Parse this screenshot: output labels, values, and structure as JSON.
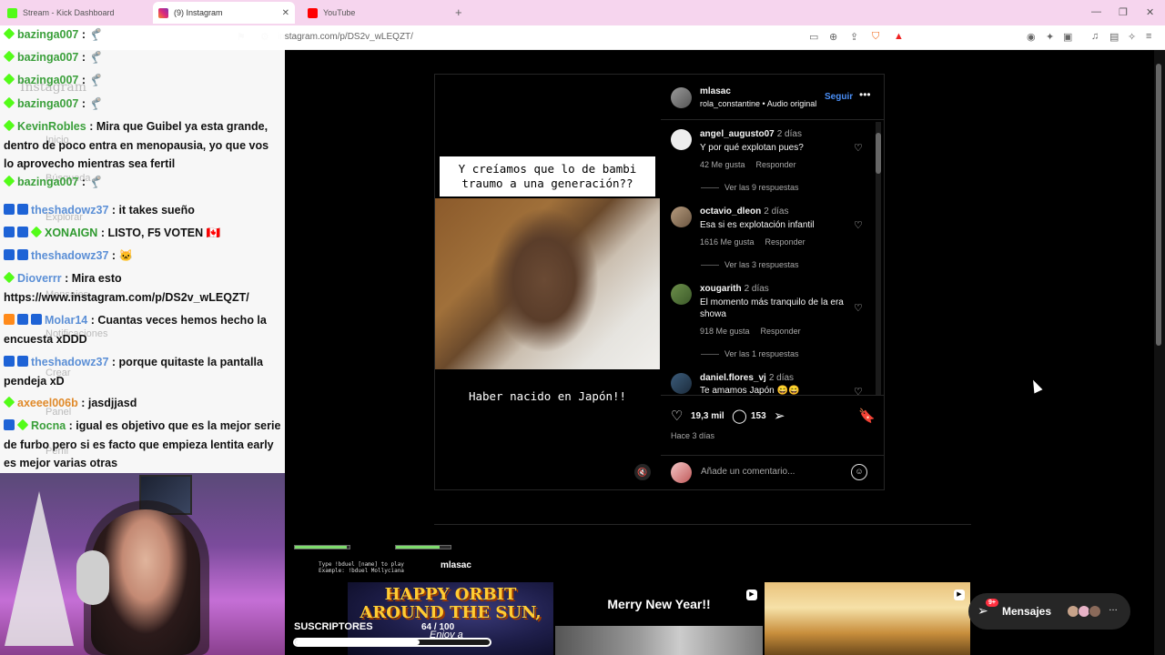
{
  "browser": {
    "tabs": [
      {
        "title": "Stream - Kick Dashboard",
        "active": false
      },
      {
        "title": "(9) Instagram",
        "active": true
      },
      {
        "title": "YouTube",
        "active": false
      }
    ],
    "url": "instagram.com/p/DS2v_wLEQZT/"
  },
  "post": {
    "author": "mlasac",
    "audio": "rola_constantine • Audio original",
    "follow_label": "Seguir",
    "overlay_text_top": "Y creíamos que lo de bambi traumo a una generación??",
    "overlay_text_bottom": "Haber nacido en Japón!!",
    "likes": "19,3 mil",
    "comments_count": "153",
    "time_ago": "Hace 3 días",
    "add_comment_placeholder": "Añade un comentario..."
  },
  "comments": [
    {
      "user": "angel_augusto07",
      "time": "2 días",
      "text": "Y por qué explotan pues?",
      "likes": "42 Me gusta",
      "reply": "Responder",
      "replies": "Ver las 9 respuestas"
    },
    {
      "user": "octavio_dleon",
      "time": "2 días",
      "text": "Esa si es explotación infantil",
      "likes": "1616 Me gusta",
      "reply": "Responder",
      "replies": "Ver las 3 respuestas"
    },
    {
      "user": "xougarith",
      "time": "2 días",
      "text": "El momento más tranquilo de la era showa",
      "likes": "918 Me gusta",
      "reply": "Responder",
      "replies": "Ver las 1 respuestas"
    },
    {
      "user": "daniel.flores_vj",
      "time": "2 días",
      "text": "Te amamos Japón 😄😄"
    }
  ],
  "below": {
    "overlay_user": "mlasac",
    "messages_label": "Mensajes",
    "messages_badge": "9+"
  },
  "stream_overlay": {
    "subs_label": "SUSCRIPTORES",
    "subs_count": "64 / 100",
    "subs_progress": 0.64,
    "duel_line1": "Type !bduel [name] to play",
    "duel_line2": "Example: !bduel Mollyciana",
    "grid1_text": "HAPPY ORBIT AROUND THE SUN,",
    "grid1_sub": "Enjoy a",
    "grid2_text": "Merry New Year!!"
  },
  "ghost_nav": [
    "Instagram",
    "Inicio",
    "Búsqueda",
    "Explorar",
    "Mensajes",
    "Notificaciones",
    "Crear",
    "Panel",
    "Perfil"
  ],
  "chat": [
    {
      "user": "bazinga007",
      "color": "#3a9f3a",
      "badges": [
        "green"
      ],
      "text": " : 🦿"
    },
    {
      "user": "bazinga007",
      "color": "#3a9f3a",
      "badges": [
        "green"
      ],
      "text": " : 🦿"
    },
    {
      "user": "bazinga007",
      "color": "#3a9f3a",
      "badges": [
        "green"
      ],
      "text": " : 🦿"
    },
    {
      "user": "bazinga007",
      "color": "#3a9f3a",
      "badges": [
        "green"
      ],
      "text": " : 🦿"
    },
    {
      "user": "KevinRobles",
      "color": "#3a9f3a",
      "badges": [
        "green"
      ],
      "text": " : Mira que Guibel ya esta grande, dentro de poco entra en menopausia, yo que vos lo aprovecho mientras sea fertil"
    },
    {
      "user": "bazinga007",
      "color": "#3a9f3a",
      "badges": [
        "green"
      ],
      "text": " : 🦿"
    },
    {
      "user": "theshadowz37",
      "color": "#5b8fd6",
      "badges": [
        "blue",
        "blue"
      ],
      "text": " : it takes sueño"
    },
    {
      "user": "XONAIGN",
      "color": "#2f9a2f",
      "badges": [
        "blue",
        "blue",
        "green"
      ],
      "text": " : LISTO, F5 VOTEN 🇨🇦"
    },
    {
      "user": "theshadowz37",
      "color": "#5b8fd6",
      "badges": [
        "blue",
        "blue"
      ],
      "text": " : 🐱"
    },
    {
      "user": "Dioverrr",
      "color": "#5b8fd6",
      "badges": [
        "green"
      ],
      "text": " : Mira esto https://www.instagram.com/p/DS2v_wLEQZT/"
    },
    {
      "user": "Molar14",
      "color": "#5b8fd6",
      "badges": [
        "orange",
        "blue",
        "blue"
      ],
      "text": " : Cuantas veces hemos hecho la encuesta xDDD"
    },
    {
      "user": "theshadowz37",
      "color": "#5b8fd6",
      "badges": [
        "blue",
        "blue"
      ],
      "text": " : porque quitaste la pantalla pendeja xD"
    },
    {
      "user": "axeeel006b",
      "color": "#e08a2a",
      "badges": [
        "green"
      ],
      "text": " : jasdjjasd"
    },
    {
      "user": "Rocna",
      "color": "#3a9f3a",
      "badges": [
        "blue",
        "green"
      ],
      "text": " : igual es objetivo que es la mejor serie de furbo pero si es facto que empieza lentita early es mejor varias otras"
    }
  ]
}
